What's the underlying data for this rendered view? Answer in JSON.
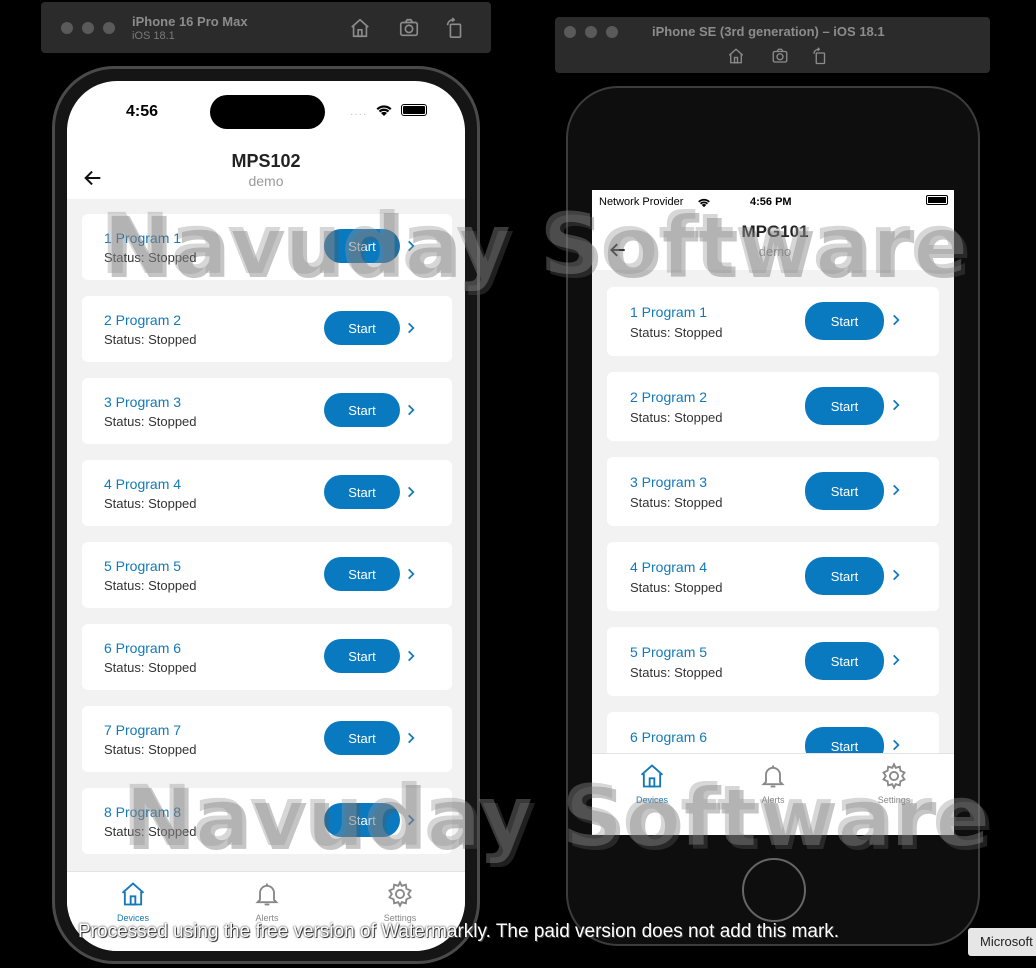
{
  "sim1": {
    "title": "iPhone 16 Pro Max",
    "subtitle": "iOS 18.1"
  },
  "sim2": {
    "title": "iPhone SE (3rd generation) – iOS 18.1"
  },
  "phone1": {
    "time": "4:56",
    "title": "MPS102",
    "subtitle": "demo",
    "programs": [
      {
        "name": "1 Program 1",
        "status": "Status: Stopped",
        "button": "Start"
      },
      {
        "name": "2 Program 2",
        "status": "Status: Stopped",
        "button": "Start"
      },
      {
        "name": "3 Program 3",
        "status": "Status: Stopped",
        "button": "Start"
      },
      {
        "name": "4 Program 4",
        "status": "Status: Stopped",
        "button": "Start"
      },
      {
        "name": "5 Program 5",
        "status": "Status: Stopped",
        "button": "Start"
      },
      {
        "name": "6 Program 6",
        "status": "Status: Stopped",
        "button": "Start"
      },
      {
        "name": "7 Program 7",
        "status": "Status: Stopped",
        "button": "Start"
      },
      {
        "name": "8 Program 8",
        "status": "Status: Stopped",
        "button": "Start"
      }
    ],
    "tabs": [
      "Devices",
      "Alerts",
      "Settings"
    ]
  },
  "phone2": {
    "carrier": "Network Provider",
    "time": "4:56 PM",
    "title": "MPG101",
    "subtitle": "demo",
    "programs": [
      {
        "name": "1 Program 1",
        "status": "Status: Stopped",
        "button": "Start"
      },
      {
        "name": "2 Program 2",
        "status": "Status: Stopped",
        "button": "Start"
      },
      {
        "name": "3 Program 3",
        "status": "Status: Stopped",
        "button": "Start"
      },
      {
        "name": "4 Program 4",
        "status": "Status: Stopped",
        "button": "Start"
      },
      {
        "name": "5 Program 5",
        "status": "Status: Stopped",
        "button": "Start"
      },
      {
        "name": "6 Program 6",
        "status": "",
        "button": "Start"
      }
    ],
    "tabs": [
      "Devices",
      "Alerts",
      "Settings"
    ]
  },
  "watermark": {
    "brand": "Navuday Software",
    "notice": "Processed using the free version of Watermarkly. The paid version does not add this mark."
  },
  "taskbar": {
    "label": "Microsoft"
  },
  "colors": {
    "accent": "#0a7ac0",
    "link": "#1479b8",
    "list_bg": "#f2f2f2"
  }
}
